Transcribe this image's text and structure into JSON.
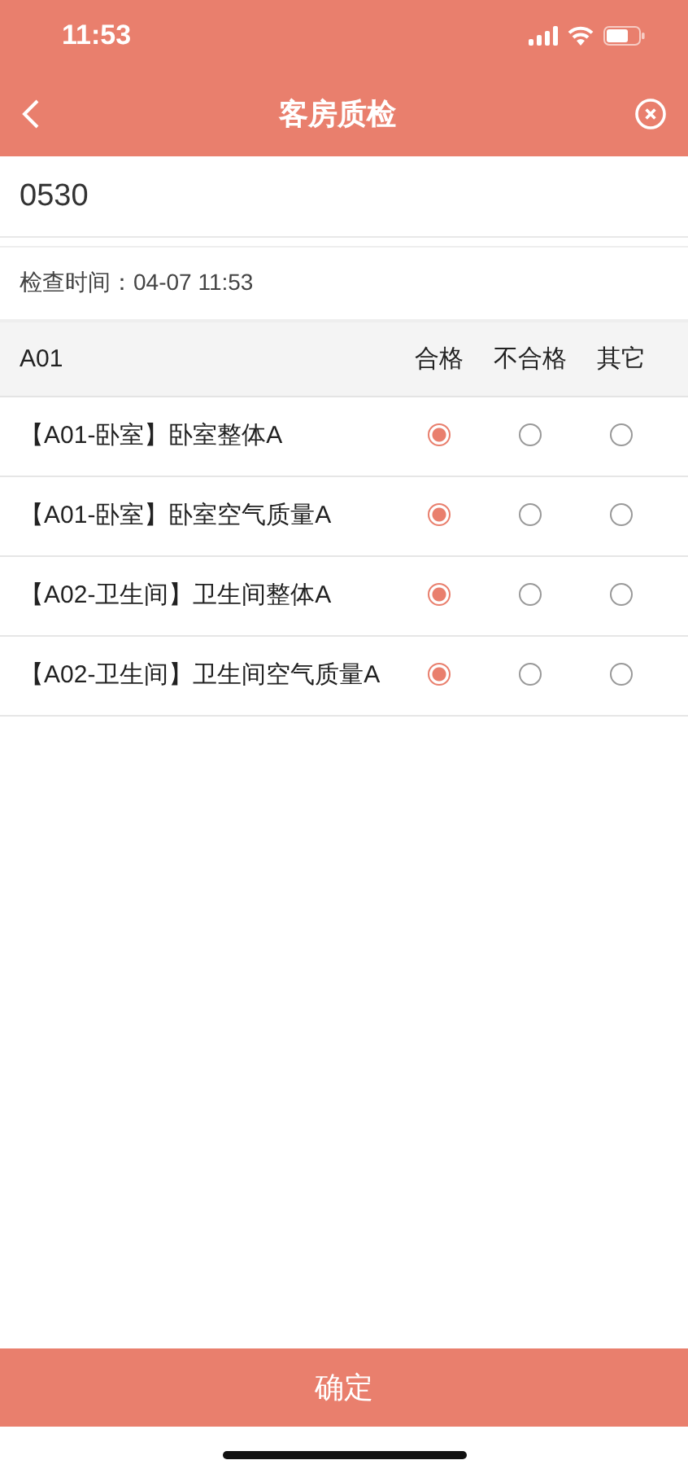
{
  "status_bar": {
    "time": "11:53"
  },
  "nav": {
    "title": "客房质检"
  },
  "room_field": {
    "value": "0530"
  },
  "check_time": "检查时间：04-07 11:53",
  "table": {
    "group": "A01",
    "columns": [
      "合格",
      "不合格",
      "其它"
    ],
    "rows": [
      {
        "label": "【A01-卧室】卧室整体A",
        "options": [
          {
            "selected": true
          },
          {
            "selected": false
          },
          {
            "selected": false
          }
        ]
      },
      {
        "label": "【A01-卧室】卧室空气质量A",
        "options": [
          {
            "selected": true
          },
          {
            "selected": false
          },
          {
            "selected": false
          }
        ]
      },
      {
        "label": "【A02-卫生间】卫生间整体A",
        "options": [
          {
            "selected": true
          },
          {
            "selected": false
          },
          {
            "selected": false
          }
        ]
      },
      {
        "label": "【A02-卫生间】卫生间空气质量A",
        "options": [
          {
            "selected": true
          },
          {
            "selected": false
          },
          {
            "selected": false
          }
        ]
      }
    ]
  },
  "confirm_button": "确定"
}
